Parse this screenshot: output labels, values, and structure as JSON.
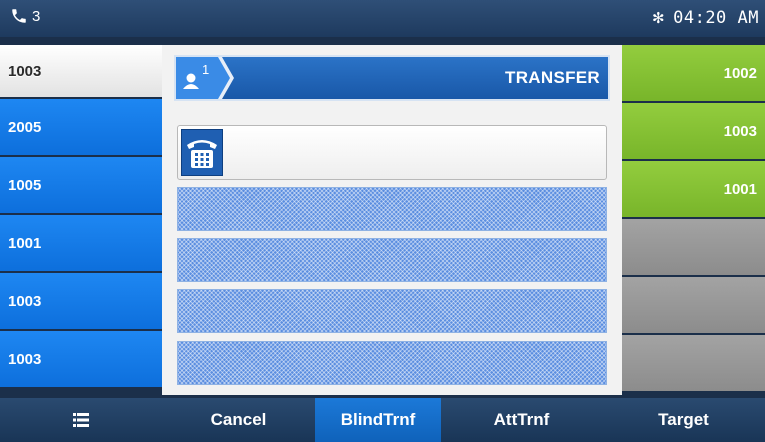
{
  "status": {
    "line_count": "3",
    "time": "04:20 AM",
    "bluetooth_icon": "bluetooth-icon",
    "phone_icon": "handset-icon"
  },
  "left_keys": [
    {
      "label": "1003",
      "state": "active"
    },
    {
      "label": "2005",
      "state": "normal"
    },
    {
      "label": "1005",
      "state": "normal"
    },
    {
      "label": "1001",
      "state": "normal"
    },
    {
      "label": "1003",
      "state": "normal"
    },
    {
      "label": "1003",
      "state": "normal"
    }
  ],
  "right_keys": [
    {
      "label": "1002",
      "color": "green"
    },
    {
      "label": "1003",
      "color": "green"
    },
    {
      "label": "1001",
      "color": "green"
    },
    {
      "label": "",
      "color": "gray"
    },
    {
      "label": "",
      "color": "gray"
    },
    {
      "label": "",
      "color": "gray"
    }
  ],
  "dialog": {
    "account_badge": "1",
    "title": "TRANSFER",
    "input_value": "",
    "input_icon": "desk-phone-icon"
  },
  "softkeys": {
    "menu_icon": "list-menu-icon",
    "cancel": "Cancel",
    "blind": "BlindTrnf",
    "att": "AttTrnf",
    "target": "Target"
  },
  "colors": {
    "blue_key": "#1e87f2",
    "green_key": "#8cc63f",
    "gray_key": "#9a9a9a",
    "header_blue": "#1f62b4",
    "selected_softkey": "#1c79d8"
  }
}
